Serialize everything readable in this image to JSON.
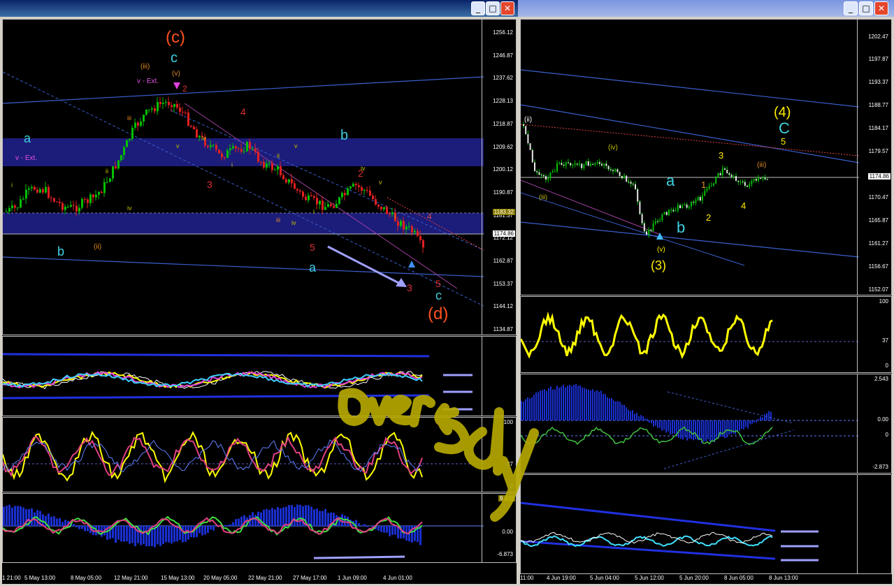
{
  "colors": {
    "background": "#000000",
    "zone": "#1c1c7a",
    "bull_candle": "#00c000",
    "bear_candle": "#e02020",
    "cyan": "#3fd0e0",
    "orange": "#e08a20",
    "red": "#e03030",
    "yellow": "#ffee00",
    "trend_blue": "#3a5fcd",
    "arrow_lavender": "#a0a0ff",
    "overlay_olive": "#b5a800"
  },
  "left_window": {
    "controls": [
      "minimize-icon",
      "maximize-icon",
      "close-icon"
    ],
    "price_ticks": [
      "1256.12",
      "1246.87",
      "1237.62",
      "1228.13",
      "1218.87",
      "1209.62",
      "1200.12",
      "1190.87",
      "1181.37",
      "1172.12",
      "1162.87",
      "1153.37",
      "1144.12",
      "1134.87"
    ],
    "current_price": "1174.86",
    "marker_price": "1183.32",
    "osc2_ticks": [
      "100",
      "37",
      "0"
    ],
    "osc3_ticks": [
      "9.692",
      "0.00",
      "-6.873"
    ],
    "x_labels": [
      "1 21:00",
      "5 May 13:00",
      "8 May 05:00",
      "12 May 21:00",
      "15 May 13:00",
      "20 May 05:00",
      "22 May 21:00",
      "27 May 17:00",
      "1 Jun 09:00",
      "4 Jun 01:00"
    ],
    "wave_labels": {
      "big_c": "(c)",
      "big_d": "(d)",
      "c_top": "c",
      "v_top": "(v)",
      "iii_top": "(iii)",
      "v_ext_top": "v - Ext.",
      "two_top": "2",
      "four_red": "4",
      "a_left": "a",
      "v_ext_left": "v - Ext.",
      "b_left": "b",
      "ii_left": "(ii)",
      "three_red": "3",
      "b_cyan": "b",
      "two_red2": "2",
      "five_red": "5",
      "a_cyan": "a",
      "three_red2": "3",
      "five_red2": "5",
      "c_cyan": "c",
      "four_pale": "4"
    }
  },
  "right_window": {
    "controls": [
      "minimize-icon",
      "maximize-icon",
      "close-icon"
    ],
    "price_ticks": [
      "1202.47",
      "1197.87",
      "1193.37",
      "1188.77",
      "1184.17",
      "1179.57",
      "1174.86",
      "1170.47",
      "1165.87",
      "1161.27",
      "1156.67",
      "1152.07"
    ],
    "current_price": "1174.86",
    "rsi_ticks": [
      "100",
      "37",
      "0"
    ],
    "macd_ticks": [
      "2.543",
      "0.00",
      "0",
      "-2.873"
    ],
    "x_labels": [
      "11:00",
      "4 Jun 19:00",
      "5 Jun 04:00",
      "5 Jun 12:00",
      "5 Jun 20:00",
      "8 Jun 05:00",
      "8 Jun 13:00"
    ],
    "wave_labels": {
      "four_big": "(4)",
      "c_big": "C",
      "five_small": "5",
      "three_small": "3",
      "iv_small": "(iv)",
      "iii_small": "(iii)",
      "ii_small": "(ii)",
      "a_cyan": "a",
      "b_cyan": "b",
      "one_small": "1",
      "two_small": "2",
      "four_small": "4",
      "three_big": "(3)",
      "v_small": "(v)"
    }
  },
  "overlay_text": "Over sold"
}
